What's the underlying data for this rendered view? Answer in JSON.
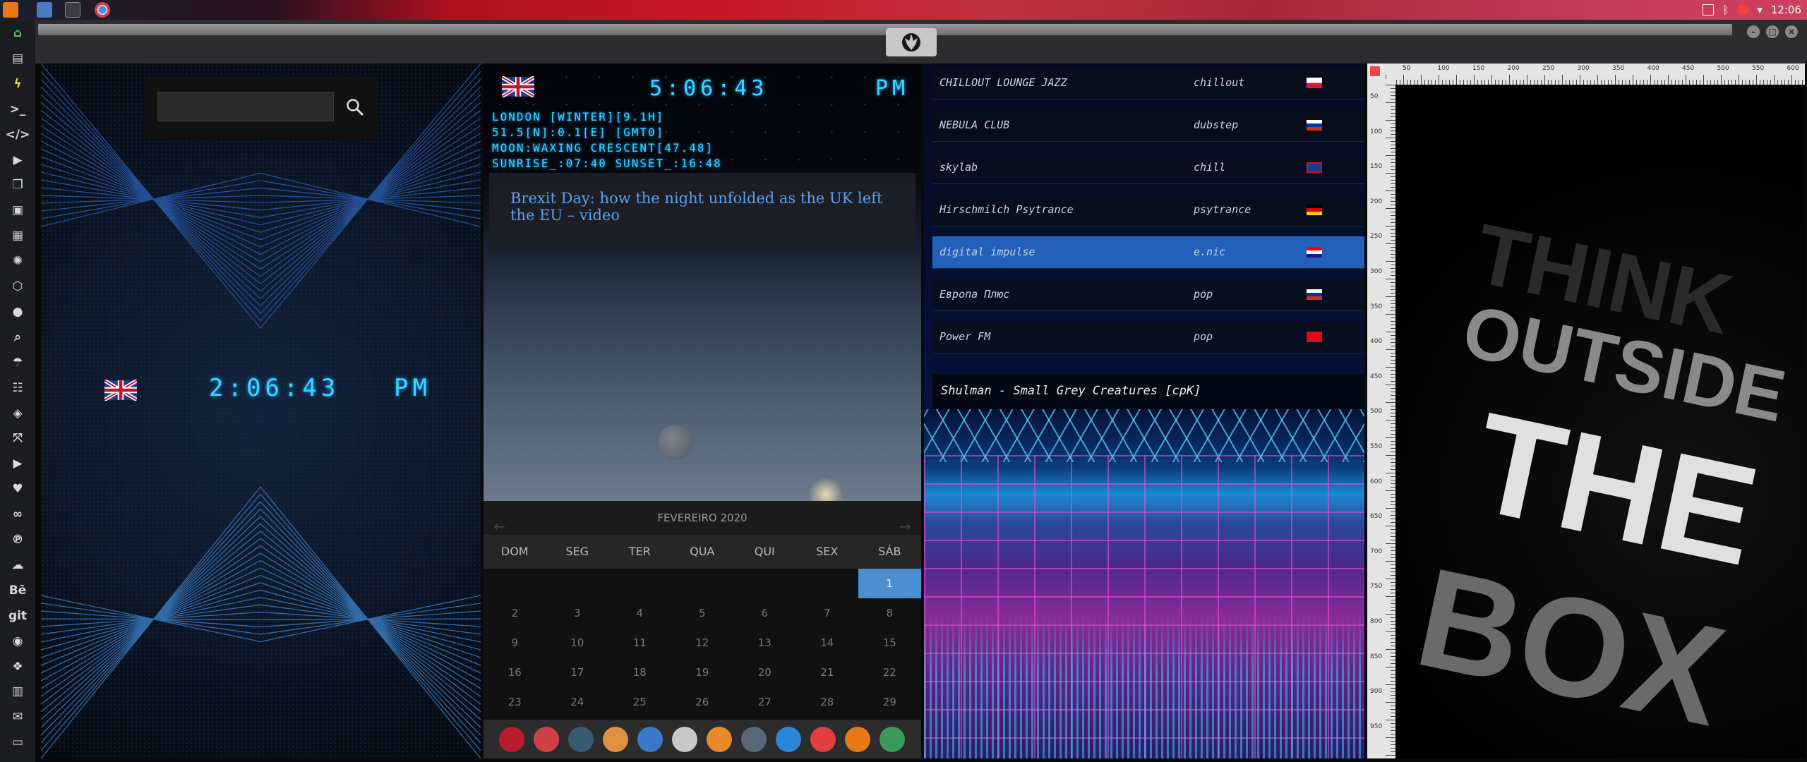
{
  "top_panel": {
    "clock": "12:06",
    "colors": {
      "accent": "#c81828"
    }
  },
  "launcher": {
    "items": [
      {
        "icon": "home-icon",
        "glyph": "⌂"
      },
      {
        "icon": "document-icon",
        "glyph": "▤"
      },
      {
        "icon": "bolt-icon",
        "glyph": "ϟ"
      },
      {
        "icon": "terminal-icon",
        "glyph": ">_"
      },
      {
        "icon": "code-icon",
        "glyph": "</>"
      },
      {
        "icon": "play-icon",
        "glyph": "▶"
      },
      {
        "icon": "files-icon",
        "glyph": "❐"
      },
      {
        "icon": "image-icon",
        "glyph": "▣"
      },
      {
        "icon": "news-icon",
        "glyph": "▦"
      },
      {
        "icon": "aperture-icon",
        "glyph": "✺"
      },
      {
        "icon": "hexagon-icon",
        "glyph": "⬡"
      },
      {
        "icon": "globe-icon",
        "glyph": "●"
      },
      {
        "icon": "search-icon",
        "glyph": "⌕"
      },
      {
        "icon": "umbrella-icon",
        "glyph": "☂"
      },
      {
        "icon": "contact-icon",
        "glyph": "☷"
      },
      {
        "icon": "tag-icon",
        "glyph": "◈"
      },
      {
        "icon": "expand-icon",
        "glyph": "⤧"
      },
      {
        "icon": "youtube-icon",
        "glyph": "▶"
      },
      {
        "icon": "heart-icon",
        "glyph": "♥"
      },
      {
        "icon": "infinity-icon",
        "glyph": "∞"
      },
      {
        "icon": "pinterest-icon",
        "glyph": "℗"
      },
      {
        "icon": "cloud-icon",
        "glyph": "☁"
      },
      {
        "icon": "behance-icon",
        "glyph": "Bē"
      },
      {
        "icon": "git-icon",
        "glyph": "git"
      },
      {
        "icon": "github-icon",
        "glyph": "◉"
      },
      {
        "icon": "cubes-icon",
        "glyph": "❖"
      },
      {
        "icon": "map-icon",
        "glyph": "▥"
      },
      {
        "icon": "mail-icon",
        "glyph": "✉"
      },
      {
        "icon": "chat-icon",
        "glyph": "▭"
      }
    ]
  },
  "clock_left": {
    "search_placeholder": "",
    "time": "2:06:43",
    "ampm": "PM"
  },
  "clock_mid": {
    "time": "5:06:43",
    "ampm": "PM",
    "info": [
      "LONDON [WINTER][9.1H]",
      "51.5[N]:0.1[E] [GMT0]",
      "MOON:WAXING CRESCENT[47.48]",
      "SUNRISE_:07:40 SUNSET_:16:48"
    ],
    "news_headline": "Brexit Day: how the night unfolded as the UK left the EU – video"
  },
  "calendar": {
    "month": "FEVEREIRO 2020",
    "weekdays": [
      "DOM",
      "SEG",
      "TER",
      "QUA",
      "QUI",
      "SEX",
      "SÁB"
    ],
    "weeks": [
      [
        "",
        "",
        "",
        "",
        "",
        "",
        "1"
      ],
      [
        "2",
        "3",
        "4",
        "5",
        "6",
        "7",
        "8"
      ],
      [
        "9",
        "10",
        "11",
        "12",
        "13",
        "14",
        "15"
      ],
      [
        "16",
        "17",
        "18",
        "19",
        "20",
        "21",
        "22"
      ],
      [
        "23",
        "24",
        "25",
        "26",
        "27",
        "28",
        "29"
      ]
    ],
    "selected": "1"
  },
  "dock": {
    "icons": [
      {
        "name": "launchpad-icon",
        "color": "#b81c2c"
      },
      {
        "name": "hourglass-icon",
        "color": "#d04048"
      },
      {
        "name": "world-icon",
        "color": "#3a5a70"
      },
      {
        "name": "photos-icon",
        "color": "#e09040"
      },
      {
        "name": "translate-icon",
        "color": "#3a78c8"
      },
      {
        "name": "calculator-icon",
        "color": "#c8c8c8"
      },
      {
        "name": "finder-icon",
        "color": "#e88a28"
      },
      {
        "name": "clock-icon",
        "color": "#586878"
      },
      {
        "name": "browser-icon",
        "color": "#2a88d8"
      },
      {
        "name": "calendar-icon",
        "color": "#e04040"
      },
      {
        "name": "sublime-icon",
        "color": "#e87818"
      },
      {
        "name": "yandex-icon",
        "color": "#3a9a5a"
      }
    ]
  },
  "radio": {
    "stations": [
      {
        "name": "CHILLOUT LOUNGE JAZZ",
        "genre": "chillout",
        "flag": "pl"
      },
      {
        "name": "NEBULA CLUB",
        "genre": "dubstep",
        "flag": "ru"
      },
      {
        "name": "skylab",
        "genre": "chill",
        "flag": "uk"
      },
      {
        "name": "Hirschmilch Psytrance",
        "genre": "psytrance",
        "flag": "de"
      },
      {
        "name": "digital impulse",
        "genre": "e.nic",
        "flag": "hr"
      },
      {
        "name": "Европа Плюс",
        "genre": "pop",
        "flag": "ru"
      },
      {
        "name": "Power FM",
        "genre": "pop",
        "flag": "tr"
      }
    ],
    "active_index": 4,
    "now_playing": "Shulman - Small Grey Creatures [cpK]"
  },
  "ruler": {
    "top_ticks": [
      "50",
      "100",
      "150",
      "200",
      "250",
      "300",
      "350",
      "400",
      "450",
      "500",
      "550",
      "600"
    ],
    "left_ticks": [
      "50",
      "100",
      "150",
      "200",
      "250",
      "300",
      "350",
      "400",
      "450",
      "500",
      "550",
      "600",
      "650",
      "700",
      "750",
      "800",
      "850",
      "900",
      "950"
    ]
  },
  "poster": {
    "words": [
      "THINK",
      "OUTSIDE",
      "THE",
      "BOX"
    ]
  }
}
